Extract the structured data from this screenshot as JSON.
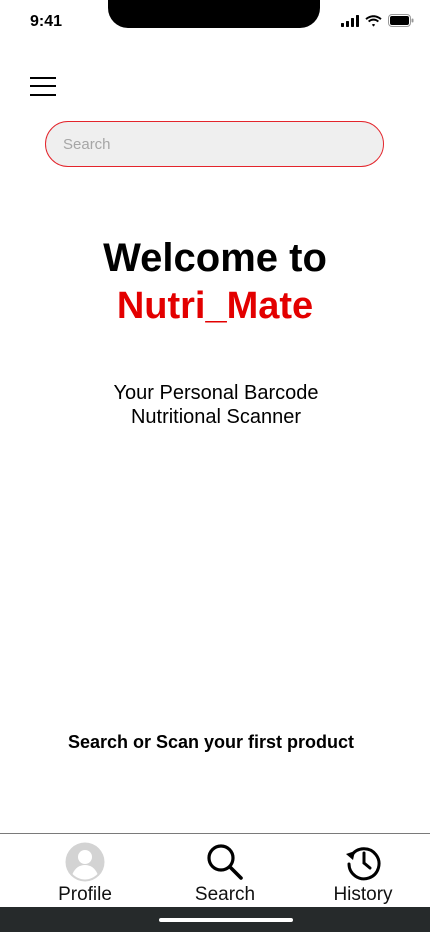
{
  "status_bar": {
    "time": "9:41"
  },
  "header": {
    "menu_icon": "hamburger-icon"
  },
  "search": {
    "placeholder": "Search",
    "value": ""
  },
  "welcome": {
    "title": "Welcome to",
    "app_name": "Nutri_Mate",
    "tagline": "Your Personal Barcode Nutritional Scanner"
  },
  "prompt": "Search or Scan your first product",
  "bottom_nav": {
    "items": [
      {
        "label": "Profile",
        "icon": "profile-icon"
      },
      {
        "label": "Search",
        "icon": "search-icon"
      },
      {
        "label": "History",
        "icon": "history-icon"
      }
    ]
  },
  "colors": {
    "accent": "#e30000",
    "search_border": "#e3242b",
    "search_bg": "#efefef",
    "home_bar": "#262a2b"
  }
}
